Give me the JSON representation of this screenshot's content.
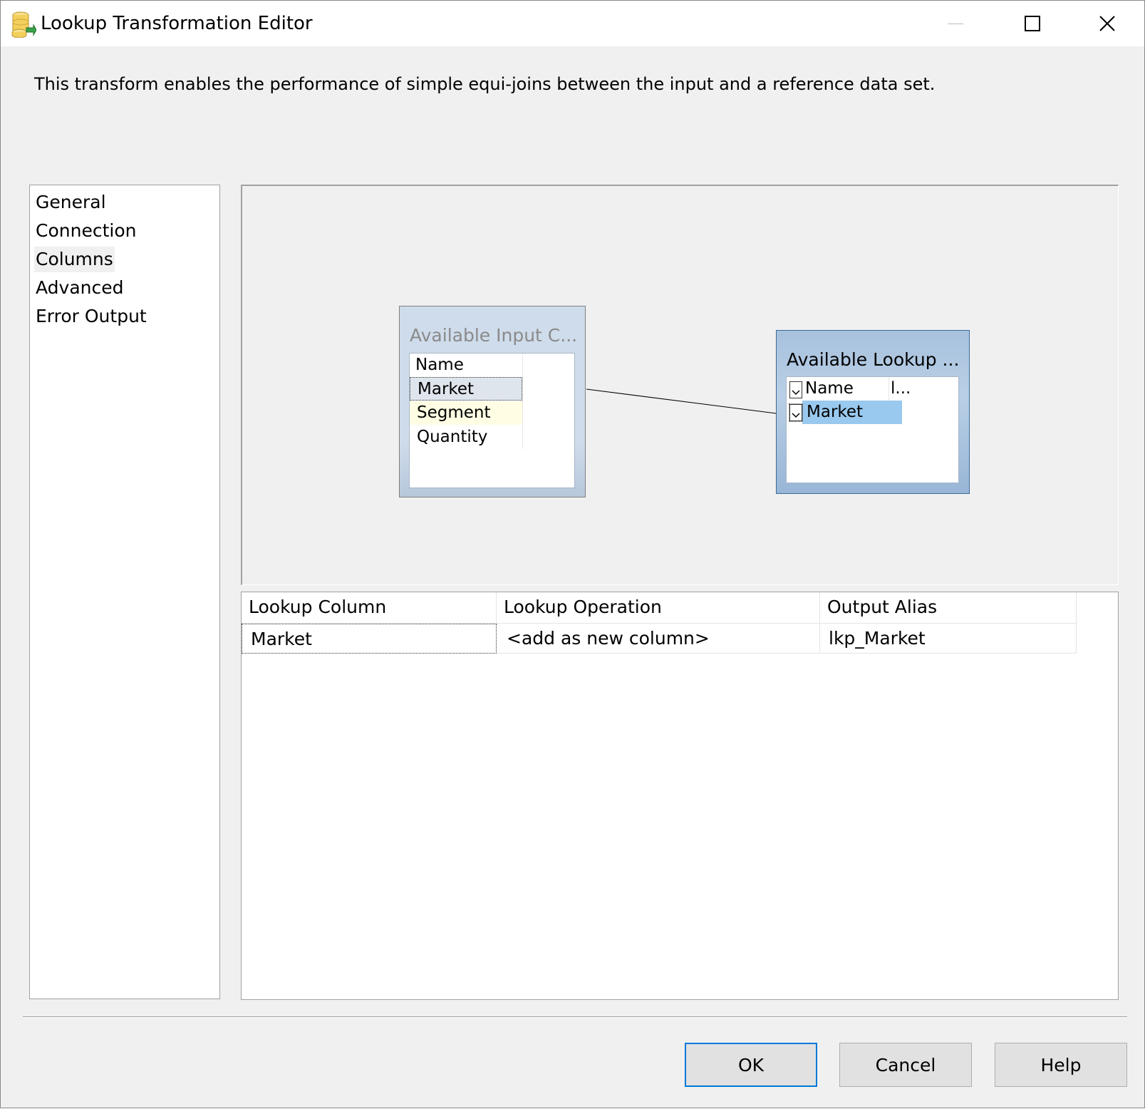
{
  "window": {
    "title": "Lookup Transformation Editor",
    "icon": "lookup-database-icon"
  },
  "description": "This transform enables the performance of simple equi-joins between the input and a reference data set.",
  "nav": {
    "items": [
      {
        "label": "General"
      },
      {
        "label": "Connection"
      },
      {
        "label": "Columns",
        "selected": true
      },
      {
        "label": "Advanced"
      },
      {
        "label": "Error Output"
      }
    ]
  },
  "input_table": {
    "title": "Available Input C...",
    "header": "Name",
    "rows": [
      "Market",
      "Segment",
      "Quantity"
    ]
  },
  "lookup_table": {
    "title": "Available Lookup ...",
    "header": "Name",
    "header2": "l...",
    "rows": [
      "Market"
    ]
  },
  "grid": {
    "columns": [
      "Lookup Column",
      "Lookup Operation",
      "Output Alias"
    ],
    "rows": [
      {
        "lookup_column": "Market",
        "operation": "<add as new column>",
        "alias": "lkp_Market"
      }
    ]
  },
  "buttons": {
    "ok": "OK",
    "cancel": "Cancel",
    "help": "Help"
  },
  "colors": {
    "selection": "#99c9ef",
    "hover_row": "#fffde4",
    "default_button_border": "#0078d7"
  }
}
